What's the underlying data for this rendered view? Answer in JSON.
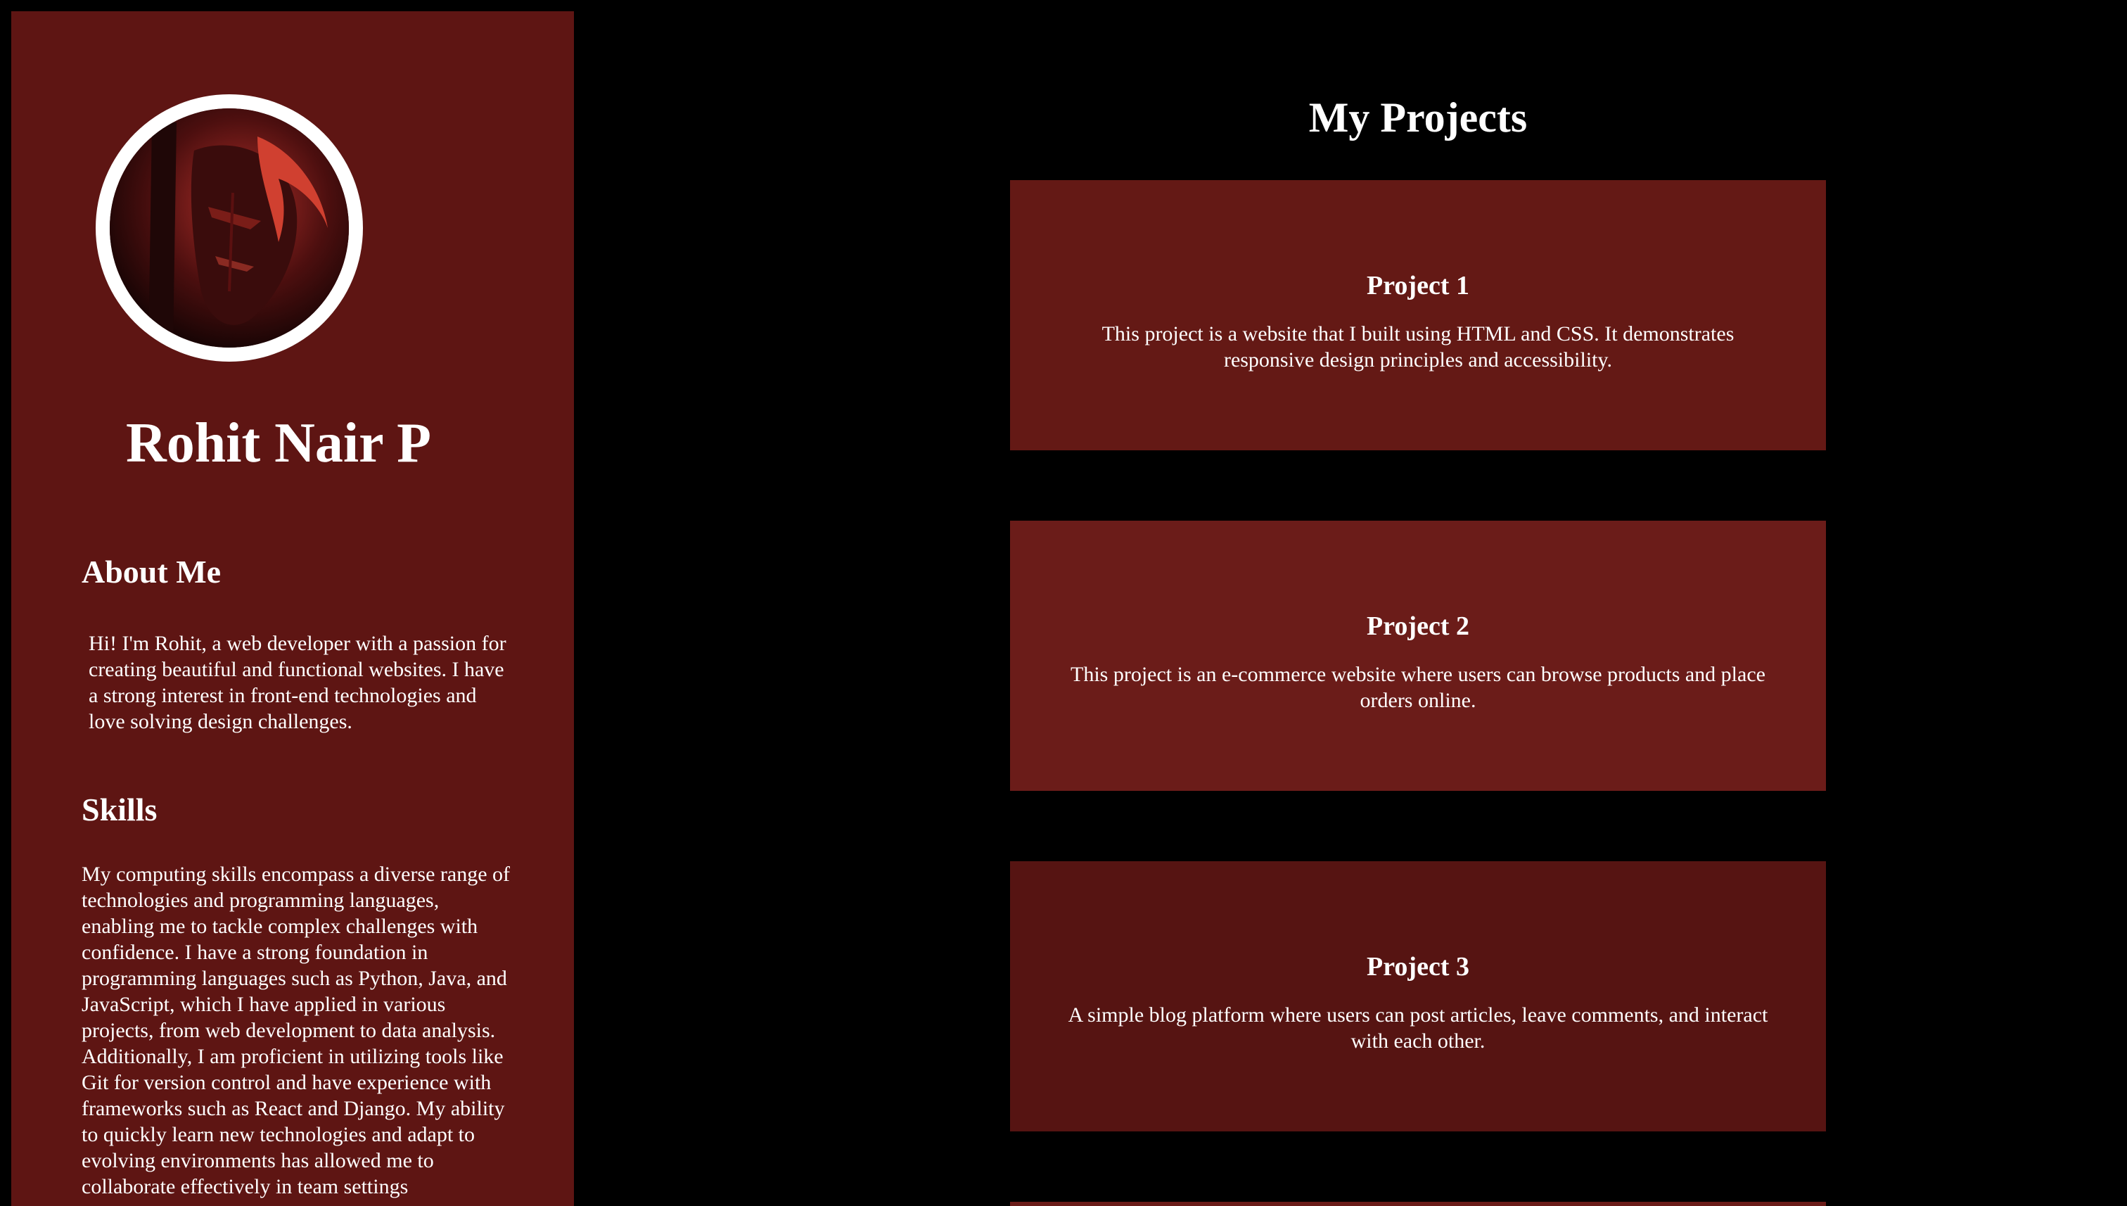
{
  "sidebar": {
    "name": "Rohit Nair P",
    "about": {
      "title": "About Me",
      "text": "Hi! I'm Rohit, a web developer with a passion for creating beautiful and functional websites. I have a strong interest in front-end technologies and love solving design challenges."
    },
    "skills": {
      "title": "Skills",
      "text": "My computing skills encompass a diverse range of technologies and programming languages, enabling me to tackle complex challenges with confidence. I have a strong foundation in programming languages such as Python, Java, and JavaScript, which I have applied in various projects, from web development to data analysis. Additionally, I am proficient in utilizing tools like Git for version control and have experience with frameworks such as React and Django. My ability to quickly learn new technologies and adapt to evolving environments has allowed me to collaborate effectively in team settings"
    }
  },
  "main": {
    "title": "My Projects",
    "projects": [
      {
        "title": "Project 1",
        "description": "This project is a website that I built using HTML and CSS. It demonstrates responsive design principles and accessibility."
      },
      {
        "title": "Project 2",
        "description": "This project is an e-commerce website where users can browse products and place orders online."
      },
      {
        "title": "Project 3",
        "description": "A simple blog platform where users can post articles, leave comments, and interact with each other."
      }
    ]
  },
  "colors": {
    "page_background": "#000000",
    "sidebar_background": "#5e1513",
    "card_background": "#641915",
    "text": "#ffffff"
  }
}
